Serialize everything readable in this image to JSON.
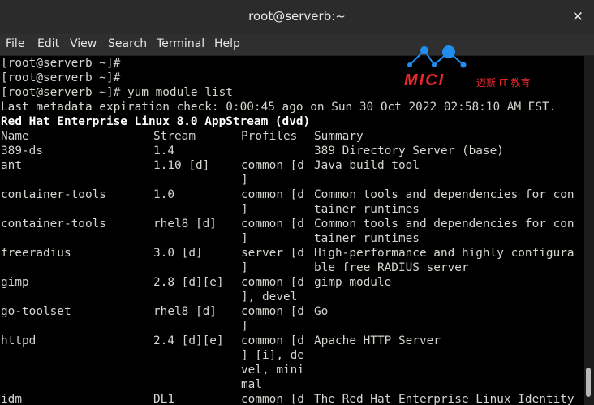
{
  "window": {
    "title": "root@serverb:~",
    "close_glyph": "✕"
  },
  "menu": [
    "File",
    "Edit",
    "View",
    "Search",
    "Terminal",
    "Help"
  ],
  "logo": {
    "brand": "MICI",
    "tagline": "迈斯 IT 教育",
    "colors": {
      "primary": "#e8262b",
      "accent": "#1f8ef0"
    }
  },
  "terminal": {
    "lines": [
      "[root@serverb ~]#",
      "[root@serverb ~]#",
      "[root@serverb ~]# yum module list",
      "Last metadata expiration check: 0:00:45 ago on Sun 30 Oct 2022 02:58:10 AM EST."
    ],
    "repo_header": "Red Hat Enterprise Linux 8.0 AppStream (dvd)",
    "table": {
      "headers": [
        "Name",
        "Stream",
        "Profiles",
        "Summary"
      ],
      "rows": [
        [
          "389-ds",
          "1.4",
          "",
          "389 Directory Server (base)"
        ],
        [
          "ant",
          "1.10 [d]",
          "common [d",
          "Java build tool"
        ],
        [
          "",
          "",
          "]",
          ""
        ],
        [
          "container-tools",
          "1.0",
          "common [d",
          "Common tools and dependencies for con"
        ],
        [
          "",
          "",
          "]",
          "tainer runtimes"
        ],
        [
          "container-tools",
          "rhel8 [d]",
          "common [d",
          "Common tools and dependencies for con"
        ],
        [
          "",
          "",
          "]",
          "tainer runtimes"
        ],
        [
          "freeradius",
          "3.0 [d]",
          "server [d",
          "High-performance and highly configura"
        ],
        [
          "",
          "",
          "]",
          "ble free RADIUS server"
        ],
        [
          "gimp",
          "2.8 [d][e]",
          "common [d",
          "gimp module"
        ],
        [
          "",
          "",
          "], devel",
          ""
        ],
        [
          "go-toolset",
          "rhel8 [d]",
          "common [d",
          "Go"
        ],
        [
          "",
          "",
          "]",
          ""
        ],
        [
          "httpd",
          "2.4 [d][e]",
          "common [d",
          "Apache HTTP Server"
        ],
        [
          "",
          "",
          "] [i], de",
          ""
        ],
        [
          "",
          "",
          "vel, mini",
          ""
        ],
        [
          "",
          "",
          "mal",
          ""
        ],
        [
          "idm",
          "DL1",
          "common [d",
          "The Red Hat Enterprise Linux Identity"
        ]
      ]
    },
    "colors": {
      "background": "#000000",
      "foreground": "#d3d7cf",
      "bold": "#ffffff"
    }
  }
}
